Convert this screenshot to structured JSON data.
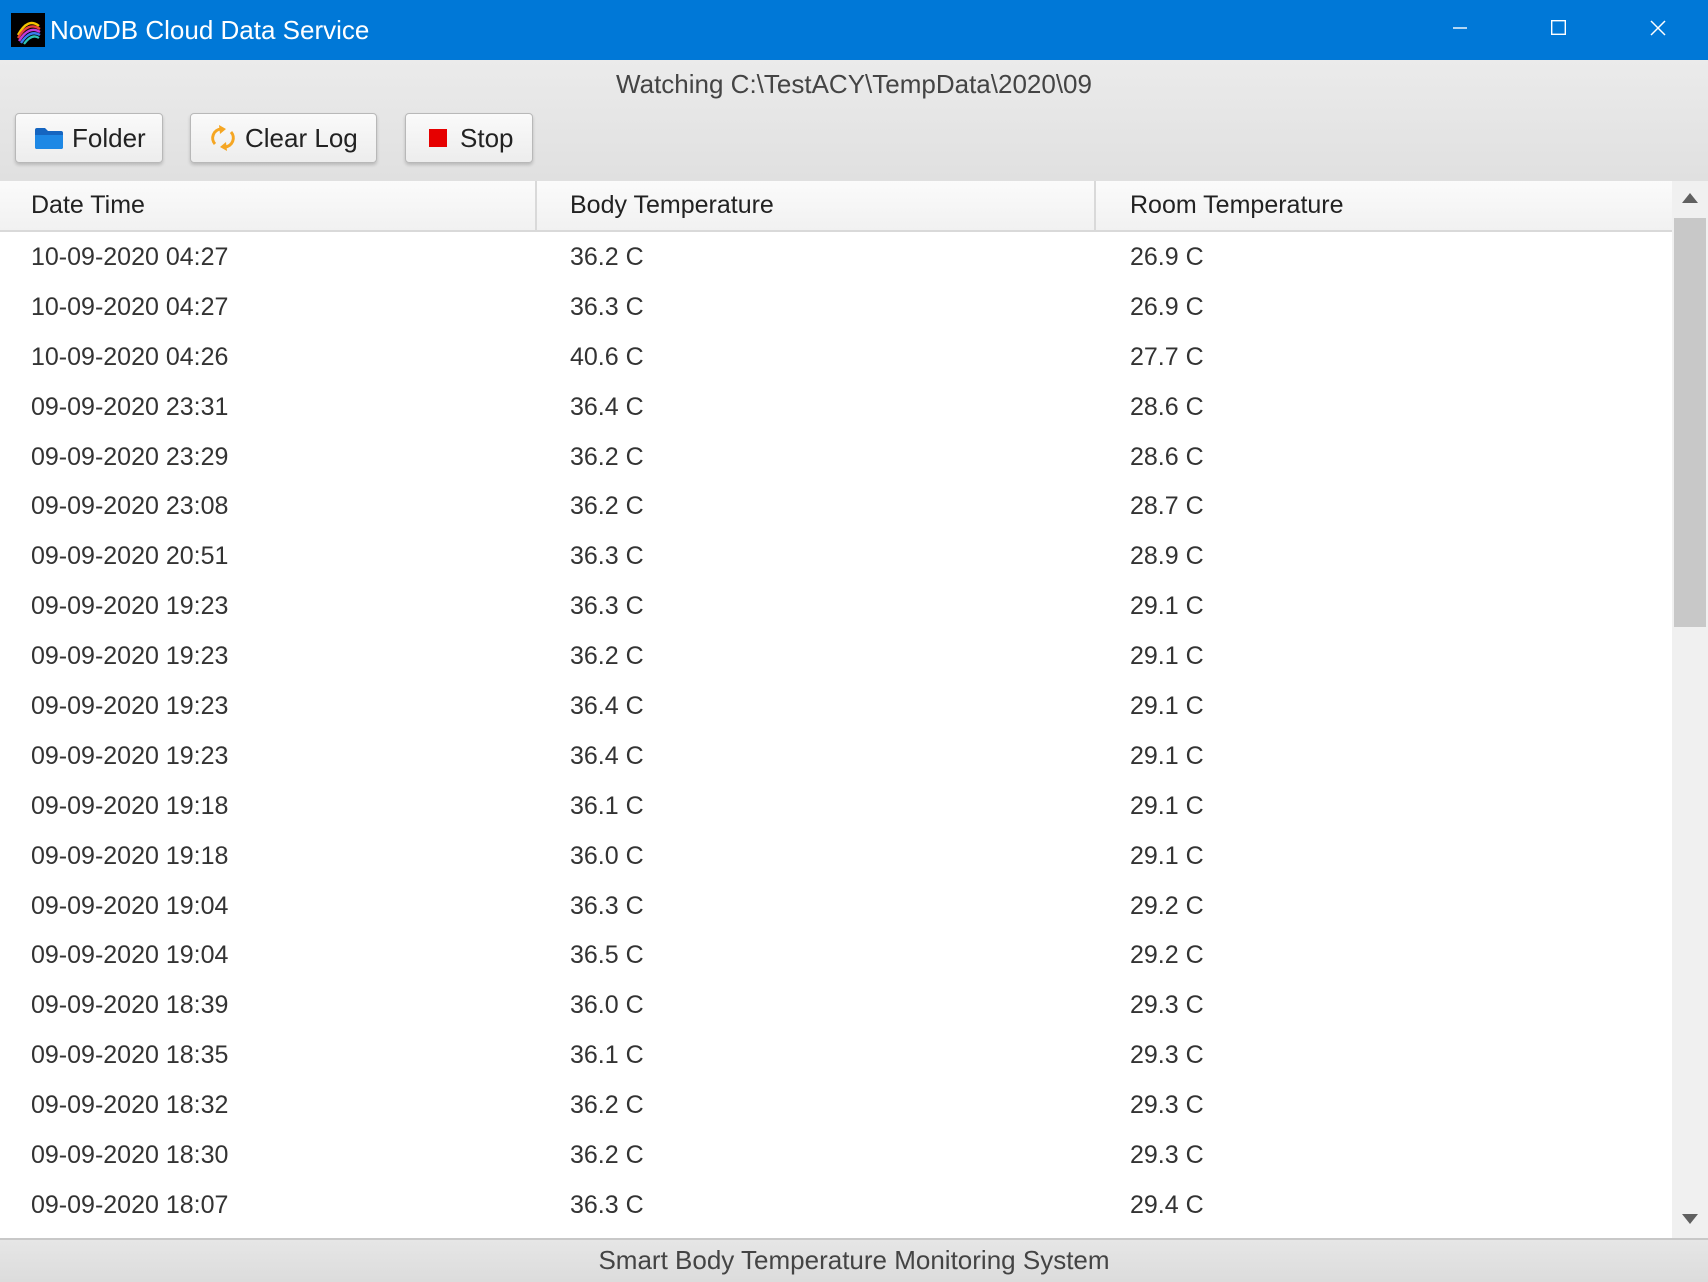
{
  "window": {
    "title": "NowDB Cloud Data Service",
    "logo_icon": "nowdb-logo-icon",
    "controls": [
      "minimize-icon",
      "maximize-icon",
      "close-icon"
    ]
  },
  "toolbar": {
    "watching_text": "Watching C:\\TestACY\\TempData\\2020\\09",
    "buttons": [
      {
        "label": "Folder",
        "icon": "folder-icon",
        "icon_color": "#1e88e5"
      },
      {
        "label": "Clear Log",
        "icon": "refresh-icon",
        "icon_color": "#f5a623"
      },
      {
        "label": "Stop",
        "icon": "stop-icon",
        "icon_color": "#e60000"
      }
    ]
  },
  "table": {
    "columns": [
      "Date Time",
      "Body Temperature",
      "Room Temperature"
    ],
    "rows": [
      [
        "10-09-2020 04:27",
        "36.2 C",
        "26.9 C"
      ],
      [
        "10-09-2020 04:27",
        "36.3 C",
        "26.9 C"
      ],
      [
        "10-09-2020 04:26",
        "40.6 C",
        "27.7 C"
      ],
      [
        "09-09-2020 23:31",
        "36.4 C",
        "28.6 C"
      ],
      [
        "09-09-2020 23:29",
        "36.2 C",
        "28.6 C"
      ],
      [
        "09-09-2020 23:08",
        "36.2 C",
        "28.7 C"
      ],
      [
        "09-09-2020 20:51",
        "36.3 C",
        "28.9 C"
      ],
      [
        "09-09-2020 19:23",
        "36.3 C",
        "29.1 C"
      ],
      [
        "09-09-2020 19:23",
        "36.2 C",
        "29.1 C"
      ],
      [
        "09-09-2020 19:23",
        "36.4 C",
        "29.1 C"
      ],
      [
        "09-09-2020 19:23",
        "36.4 C",
        "29.1 C"
      ],
      [
        "09-09-2020 19:18",
        "36.1 C",
        "29.1 C"
      ],
      [
        "09-09-2020 19:18",
        "36.0 C",
        "29.1 C"
      ],
      [
        "09-09-2020 19:04",
        "36.3 C",
        "29.2 C"
      ],
      [
        "09-09-2020 19:04",
        "36.5 C",
        "29.2 C"
      ],
      [
        "09-09-2020 18:39",
        "36.0 C",
        "29.3 C"
      ],
      [
        "09-09-2020 18:35",
        "36.1 C",
        "29.3 C"
      ],
      [
        "09-09-2020 18:32",
        "36.2 C",
        "29.3 C"
      ],
      [
        "09-09-2020 18:30",
        "36.2 C",
        "29.3 C"
      ],
      [
        "09-09-2020 18:07",
        "36.3 C",
        "29.4 C"
      ]
    ]
  },
  "status": {
    "text": "Smart Body Temperature Monitoring System"
  },
  "colors": {
    "titlebar": "#0078d7",
    "scroll_thumb": "#c8c8c8"
  }
}
